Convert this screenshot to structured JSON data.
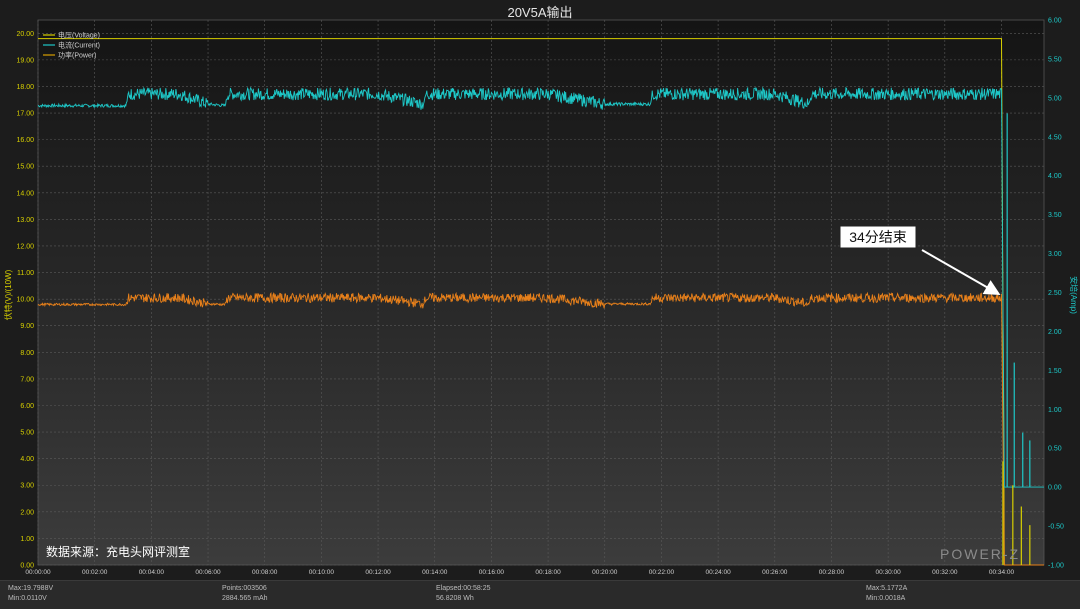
{
  "title": "20V5A输出",
  "watermark": "POWER-Z",
  "source_note": "数据来源：充电头网评测室",
  "annotation": {
    "text": "34分结束"
  },
  "legend": [
    {
      "label": "电压(Voltage)",
      "color": "#d8d000"
    },
    {
      "label": "电流(Current)",
      "color": "#1ec8c8"
    },
    {
      "label": "功率(Power)",
      "color": "#d8a000"
    }
  ],
  "footer": {
    "max_voltage": "Max:19.7988V",
    "min_voltage": "Min:0.0110V",
    "points": "Points:003506",
    "capacity": "2884.565 mAh",
    "elapsed": "Elapsed:00:58:25",
    "energy": "56.8208 Wh",
    "max_current": "Max:5.1772A",
    "min_current": "Min:0.0018A"
  },
  "chart_data": {
    "type": "line",
    "ylabel_left": "伏特(V)/(10W)",
    "ylabel_right": "安培(Amp)",
    "xlim_minutes": [
      0,
      35.5
    ],
    "ylim_left": [
      0,
      20.5
    ],
    "ylim_right": [
      -1.0,
      6.0
    ],
    "x_ticks": [
      "00:00:00",
      "00:02:00",
      "00:04:00",
      "00:06:00",
      "00:08:00",
      "00:10:00",
      "00:12:00",
      "00:14:00",
      "00:16:00",
      "00:18:00",
      "00:20:00",
      "00:22:00",
      "00:24:00",
      "00:26:00",
      "00:28:00",
      "00:30:00",
      "00:32:00",
      "00:34:00"
    ],
    "y_ticks_left": [
      "0.00",
      "1.00",
      "2.00",
      "3.00",
      "4.00",
      "5.00",
      "6.00",
      "7.00",
      "8.00",
      "9.00",
      "10.00",
      "11.00",
      "12.00",
      "13.00",
      "14.00",
      "15.00",
      "16.00",
      "17.00",
      "18.00",
      "19.00",
      "20.00"
    ],
    "y_ticks_right": [
      "-1.00",
      "-0.50",
      "0.00",
      "0.50",
      "1.00",
      "1.50",
      "2.00",
      "2.50",
      "3.00",
      "3.50",
      "4.00",
      "4.50",
      "5.00",
      "5.50",
      "6.00"
    ],
    "grid": true,
    "series": [
      {
        "name": "电压(Voltage)",
        "axis": "left",
        "x_minutes": [
          0,
          2,
          4,
          6,
          8,
          10,
          12,
          14,
          16,
          18,
          20,
          22,
          24,
          26,
          28,
          30,
          32,
          34,
          34.1
        ],
        "values": [
          19.8,
          19.8,
          19.8,
          19.8,
          19.8,
          19.8,
          19.8,
          19.8,
          19.8,
          19.8,
          19.8,
          19.8,
          19.8,
          19.8,
          19.8,
          19.8,
          19.8,
          19.8,
          0.01
        ]
      },
      {
        "name": "电流(Current)",
        "axis": "right",
        "x_minutes": [
          0,
          2,
          3.1,
          3.2,
          4,
          5,
          6,
          6.6,
          6.7,
          8,
          10,
          12,
          13.6,
          13.7,
          14,
          16,
          18,
          20,
          20.6,
          21.6,
          21.7,
          24,
          26,
          27.2,
          27.3,
          28,
          30,
          32,
          34,
          34.1,
          35.5
        ],
        "values": [
          4.9,
          4.9,
          4.9,
          5.05,
          5.05,
          5.05,
          4.92,
          4.9,
          5.05,
          5.05,
          5.05,
          5.05,
          4.92,
          5.05,
          5.05,
          5.05,
          5.05,
          4.92,
          4.92,
          4.92,
          5.05,
          5.05,
          5.05,
          4.92,
          5.05,
          5.05,
          5.05,
          5.05,
          5.05,
          0.0,
          0.0
        ]
      },
      {
        "name": "功率(Power)",
        "axis": "left",
        "unit": "10W",
        "x_minutes": [
          0,
          2,
          3.1,
          3.2,
          4,
          5,
          6,
          6.6,
          6.7,
          8,
          10,
          12,
          13.6,
          13.7,
          14,
          16,
          18,
          20,
          20.6,
          21.6,
          21.7,
          24,
          26,
          27.2,
          27.3,
          28,
          30,
          32,
          34,
          34.1,
          35.5
        ],
        "values": [
          9.8,
          9.8,
          9.8,
          10.05,
          10.05,
          10.05,
          9.82,
          9.8,
          10.05,
          10.05,
          10.05,
          10.05,
          9.82,
          10.05,
          10.05,
          10.05,
          10.05,
          9.82,
          9.82,
          9.82,
          10.05,
          10.05,
          10.05,
          9.82,
          10.05,
          10.05,
          10.05,
          10.05,
          10.05,
          0.0,
          0.0
        ]
      }
    ],
    "tail_spikes": {
      "current": [
        {
          "x_minutes": 34.2,
          "value": 4.8
        },
        {
          "x_minutes": 34.45,
          "value": 1.6
        },
        {
          "x_minutes": 34.75,
          "value": 0.7
        },
        {
          "x_minutes": 35.0,
          "value": 0.6
        }
      ],
      "power": [
        {
          "x_minutes": 34.05,
          "value": 3.9
        },
        {
          "x_minutes": 34.4,
          "value": 3.0
        },
        {
          "x_minutes": 34.7,
          "value": 2.2
        },
        {
          "x_minutes": 35.0,
          "value": 1.5
        }
      ]
    }
  }
}
